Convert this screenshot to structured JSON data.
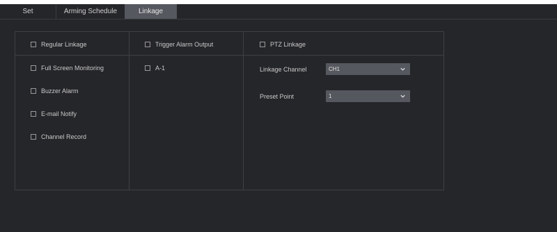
{
  "tabs": [
    {
      "label": "Set"
    },
    {
      "label": "Arming Schedule"
    },
    {
      "label": "Linkage"
    }
  ],
  "linkage": {
    "regular": {
      "header": "Regular Linkage",
      "items": [
        {
          "label": "Full Screen Monitoring"
        },
        {
          "label": "Buzzer Alarm"
        },
        {
          "label": "E-mail Notify"
        },
        {
          "label": "Channel Record"
        }
      ]
    },
    "trigger": {
      "header": "Trigger Alarm Output",
      "items": [
        {
          "label": "A-1"
        }
      ]
    },
    "ptz": {
      "header": "PTZ Linkage",
      "channel_label": "Linkage Channel",
      "channel_value": "CH1",
      "preset_label": "Preset Point",
      "preset_value": "1"
    }
  },
  "colors": {
    "background": "#252629",
    "active_tab": "#55585e",
    "border": "#3e4045",
    "text": "#c9c9c9"
  },
  "icons": {
    "dropdown": "chevron-down-icon"
  }
}
